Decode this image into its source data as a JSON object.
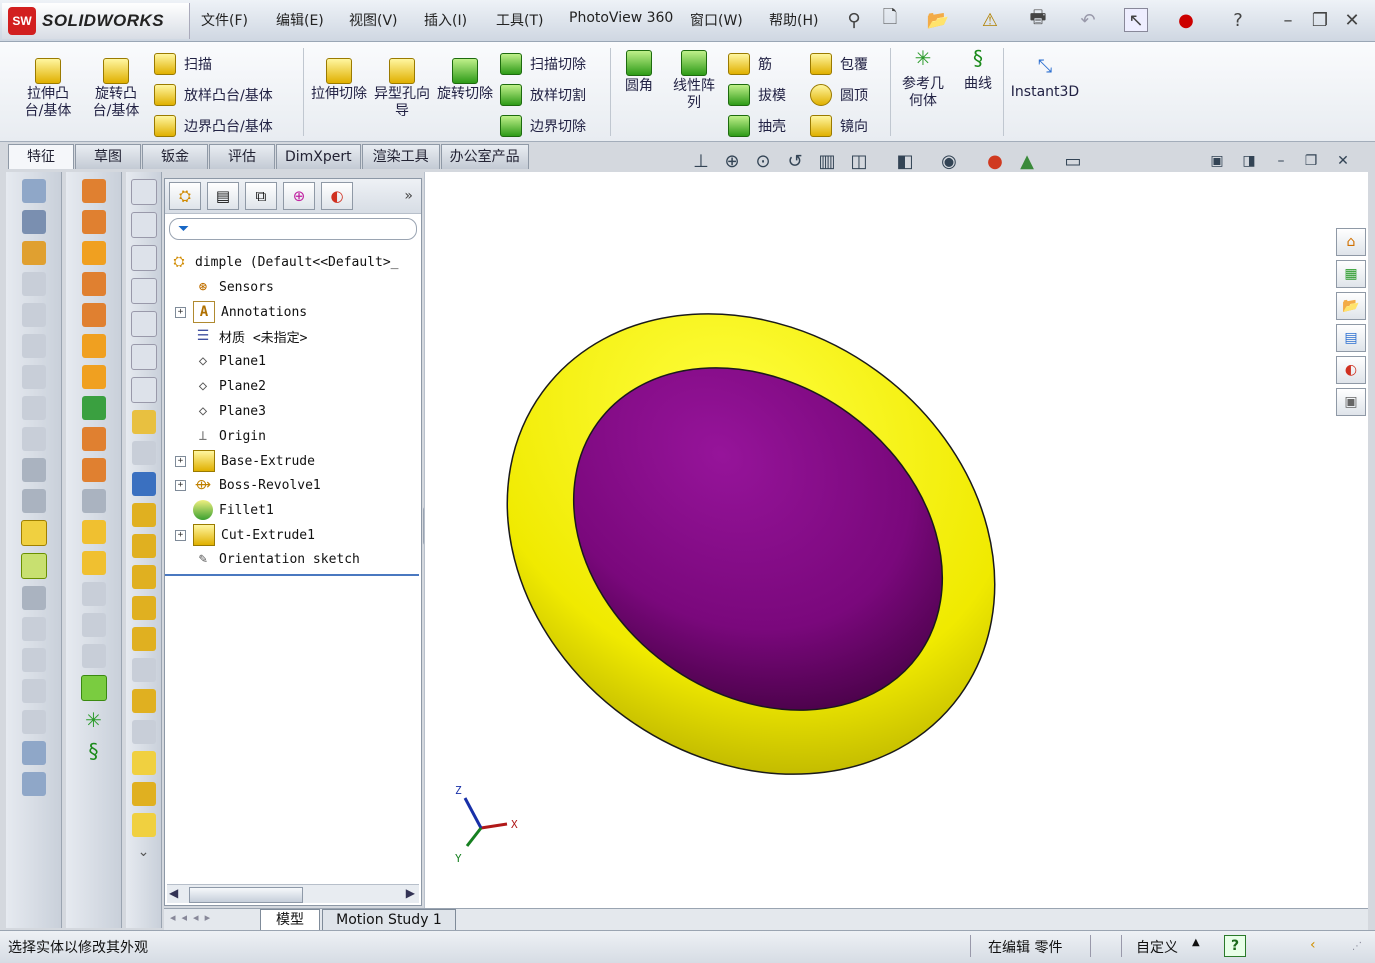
{
  "app": {
    "brand_mark": "SW",
    "brand_name": "SOLIDWORKS"
  },
  "menu": [
    "文件(F)",
    "编辑(E)",
    "视图(V)",
    "插入(I)",
    "工具(T)",
    "PhotoView 360",
    "窗口(W)",
    "帮助(H)"
  ],
  "ribbon": {
    "big": [
      {
        "label": "拉伸凸台/基体"
      },
      {
        "label": "旋转凸台/基体"
      }
    ],
    "boss_rows": [
      "扫描",
      "放样凸台/基体",
      "边界凸台/基体"
    ],
    "cut_big": [
      {
        "label": "拉伸切除"
      },
      {
        "label": "异型孔向导"
      },
      {
        "label": "旋转切除"
      }
    ],
    "cut_rows": [
      "扫描切除",
      "放样切割",
      "边界切除"
    ],
    "fillet": "圆角",
    "pattern": "线性阵列",
    "feature_rows_a": [
      "筋",
      "拔模",
      "抽壳"
    ],
    "feature_rows_b": [
      "包覆",
      "圆顶",
      "镜向"
    ],
    "ref_geom": "参考几何体",
    "curves": "曲线",
    "instant3d": "Instant3D"
  },
  "tabs": [
    "特征",
    "草图",
    "钣金",
    "评估",
    "DimXpert",
    "渲染工具",
    "办公室产品"
  ],
  "tree": {
    "root": "dimple   (Default<<Default>_",
    "items": [
      {
        "label": "Sensors",
        "expand": false
      },
      {
        "label": "Annotations",
        "expand": true
      },
      {
        "label": "材质 <未指定>",
        "expand": false
      },
      {
        "label": "Plane1",
        "expand": false
      },
      {
        "label": "Plane2",
        "expand": false
      },
      {
        "label": "Plane3",
        "expand": false
      },
      {
        "label": "Origin",
        "expand": false
      },
      {
        "label": "Base-Extrude",
        "expand": true
      },
      {
        "label": "Boss-Revolve1",
        "expand": true
      },
      {
        "label": "Fillet1",
        "expand": false
      },
      {
        "label": "Cut-Extrude1",
        "expand": true
      },
      {
        "label": "Orientation sketch",
        "expand": false
      }
    ]
  },
  "triad": {
    "x": "X",
    "y": "Y",
    "z": "Z"
  },
  "bottom_tabs": [
    "模型",
    "Motion Study 1"
  ],
  "status": {
    "message": "选择实体以修改其外观",
    "mode": "在编辑 零件",
    "units": "自定义",
    "help": "?"
  },
  "colors": {
    "part_yellow": "#f4f000",
    "cut_purple": "#7c0a7e",
    "accent": "#d21f1f"
  }
}
